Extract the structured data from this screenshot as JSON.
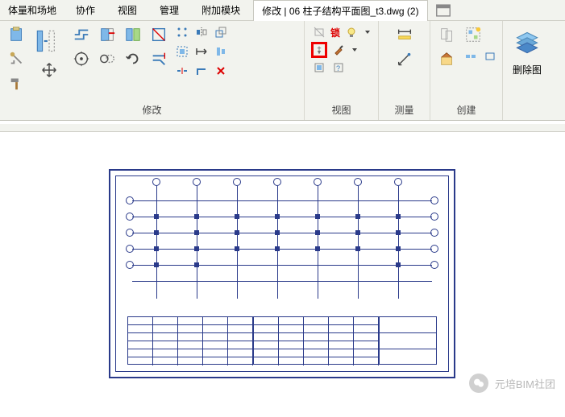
{
  "menu": {
    "items": [
      "体量和场地",
      "协作",
      "视图",
      "管理",
      "附加模块"
    ]
  },
  "tab": {
    "active": "修改 | 06 柱子结构平面图_t3.dwg (2)"
  },
  "panels": {
    "modify": "修改",
    "view": "视图",
    "measure": "测量",
    "create": "创建",
    "delete": "删除图"
  },
  "lock_text": "锁",
  "watermark": "元培BIM社团"
}
